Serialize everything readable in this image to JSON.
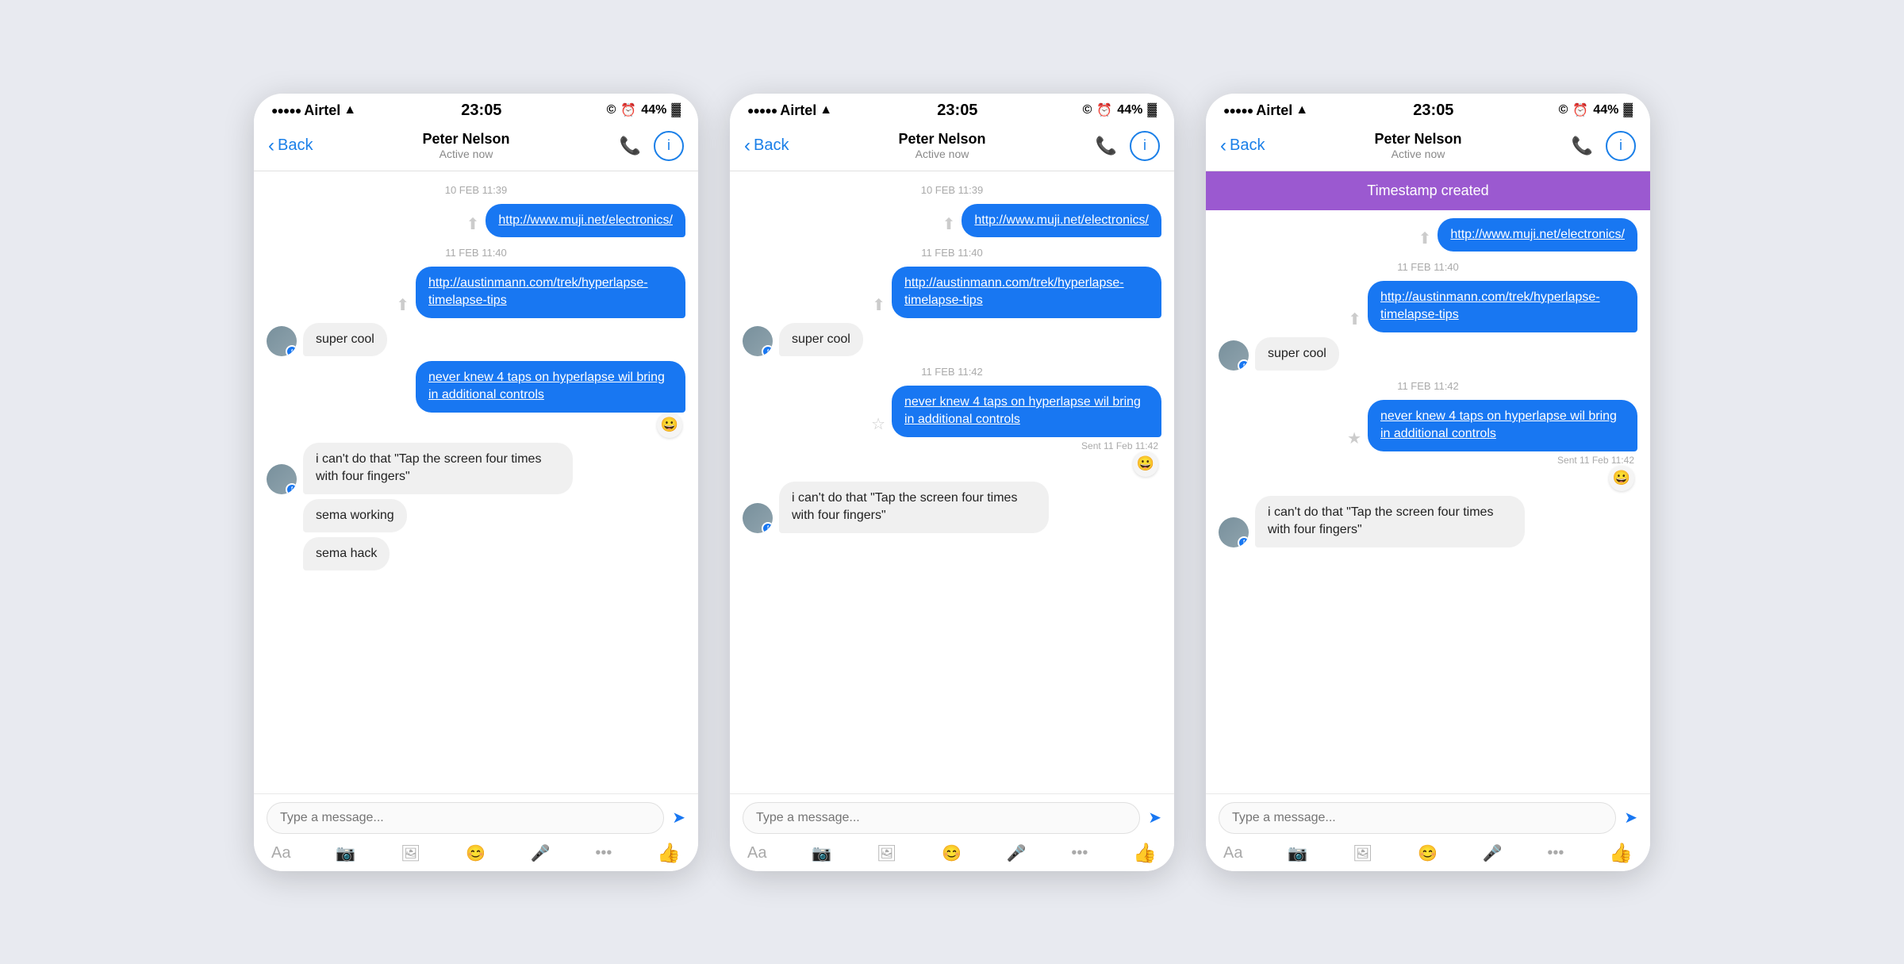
{
  "colors": {
    "blue": "#1877f2",
    "purple": "#9b59d0",
    "bubble_out": "#1877f2",
    "bubble_in": "#f0f0f0",
    "bg": "#e8eaf0"
  },
  "phones": [
    {
      "id": "phone1",
      "status_bar": {
        "dots": "●●●●●",
        "carrier": "Airtel",
        "wifi": "📶",
        "time": "23:05",
        "icons": "© ⏰ 44%",
        "battery": "🔋"
      },
      "nav": {
        "back": "Back",
        "title": "Peter Nelson",
        "subtitle": "Active now"
      },
      "timestamp_banner": null,
      "messages": [
        {
          "type": "date",
          "text": "10 FEB 11:39"
        },
        {
          "type": "outgoing_link",
          "text": "http://www.muji.net/electronics/"
        },
        {
          "type": "date",
          "text": "11 FEB 11:40"
        },
        {
          "type": "outgoing_link",
          "text": "http://austinmann.com/trek/hyperlapse-timelapse-tips"
        },
        {
          "type": "incoming",
          "text": "super cool",
          "avatar": true
        },
        {
          "type": "outgoing",
          "text": "never knew 4 taps on hyperlapse wil bring in additional controls"
        },
        {
          "type": "incoming",
          "text": "i can't do that \"Tap the screen four times with four fingers\"",
          "avatar": true
        },
        {
          "type": "incoming_plain",
          "text": "sema working"
        },
        {
          "type": "incoming_plain",
          "text": "sema hack"
        }
      ],
      "input_placeholder": "Type a message..."
    },
    {
      "id": "phone2",
      "status_bar": {
        "dots": "●●●●●",
        "carrier": "Airtel",
        "time": "23:05",
        "icons": "© ⏰ 44%"
      },
      "nav": {
        "back": "Back",
        "title": "Peter Nelson",
        "subtitle": "Active now"
      },
      "timestamp_banner": null,
      "messages": [
        {
          "type": "date",
          "text": "10 FEB 11:39"
        },
        {
          "type": "outgoing_link",
          "text": "http://www.muji.net/electronics/"
        },
        {
          "type": "date",
          "text": "11 FEB 11:40"
        },
        {
          "type": "outgoing_link",
          "text": "http://austinmann.com/trek/hyperlapse-timelapse-tips"
        },
        {
          "type": "incoming",
          "text": "super cool",
          "avatar": true
        },
        {
          "type": "date",
          "text": "11 FEB 11:42"
        },
        {
          "type": "outgoing_with_star",
          "text": "never knew 4 taps on hyperlapse wil bring in additional controls",
          "sent": "Sent 11 Feb 11:42"
        },
        {
          "type": "incoming",
          "text": "i can't do that \"Tap the screen four times with four fingers\"",
          "avatar": true
        }
      ],
      "input_placeholder": "Type a message..."
    },
    {
      "id": "phone3",
      "status_bar": {
        "dots": "●●●●●",
        "carrier": "Airtel",
        "time": "23:05",
        "icons": "© ⏰ 44%"
      },
      "nav": {
        "back": "Back",
        "title": "Peter Nelson",
        "subtitle": "Active now"
      },
      "timestamp_banner": "Timestamp created",
      "messages": [
        {
          "type": "outgoing_link",
          "text": "http://www.muji.net/electronics/"
        },
        {
          "type": "date",
          "text": "11 FEB 11:40"
        },
        {
          "type": "outgoing_link",
          "text": "http://austinmann.com/trek/hyperlapse-timelapse-tips"
        },
        {
          "type": "incoming",
          "text": "super cool",
          "avatar": true
        },
        {
          "type": "date",
          "text": "11 FEB 11:42"
        },
        {
          "type": "outgoing_with_star",
          "text": "never knew 4 taps on hyperlapse wil bring in additional controls",
          "sent": "Sent 11 Feb 11:42"
        },
        {
          "type": "incoming",
          "text": "i can't do that \"Tap the screen four times with four fingers\"",
          "avatar": true
        }
      ],
      "input_placeholder": "Type a message..."
    }
  ],
  "toolbar": {
    "items": [
      "Aa",
      "📷",
      "🖼",
      "😊",
      "🎤",
      "•••",
      "👍"
    ]
  }
}
